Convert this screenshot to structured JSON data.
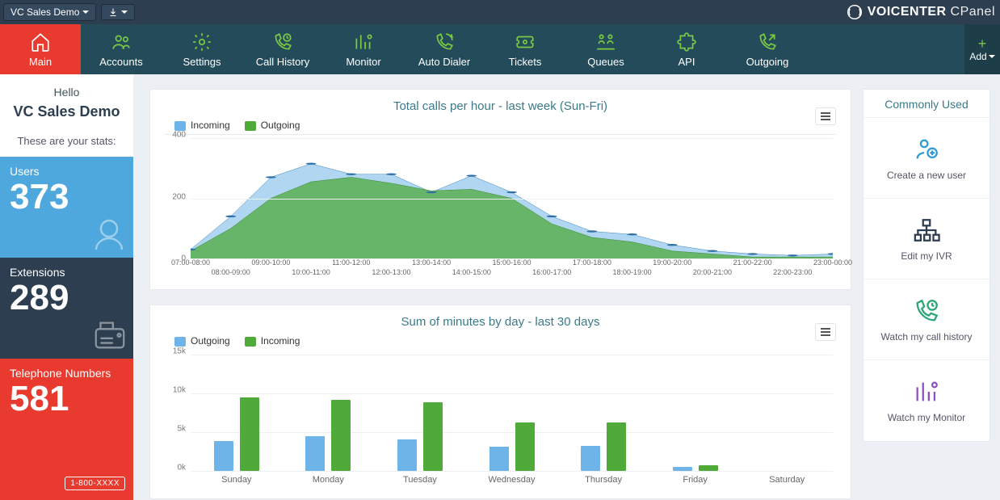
{
  "topbar": {
    "account_selector": "VC Sales Demo",
    "brand_bold": "VOICENTER",
    "brand_light": "CPanel"
  },
  "nav": {
    "items": [
      {
        "label": "Main",
        "icon": "home"
      },
      {
        "label": "Accounts",
        "icon": "users"
      },
      {
        "label": "Settings",
        "icon": "gear"
      },
      {
        "label": "Call History",
        "icon": "clock-phone"
      },
      {
        "label": "Monitor",
        "icon": "bar-person"
      },
      {
        "label": "Auto Dialer",
        "icon": "phone-cycle"
      },
      {
        "label": "Tickets",
        "icon": "ticket"
      },
      {
        "label": "Queues",
        "icon": "queue"
      },
      {
        "label": "API",
        "icon": "puzzle"
      },
      {
        "label": "Outgoing",
        "icon": "phone-out"
      }
    ],
    "add_label": "Add"
  },
  "greeting": {
    "hello": "Hello",
    "name": "VC Sales Demo",
    "stats_label": "These are your stats:"
  },
  "stats": {
    "users": {
      "label": "Users",
      "value": "373"
    },
    "extensions": {
      "label": "Extensions",
      "value": "289"
    },
    "telephone": {
      "label": "Telephone Numbers",
      "value": "581",
      "badge": "1-800-XXXX"
    }
  },
  "right": {
    "title": "Commonly Used",
    "items": [
      {
        "label": "Create a new user",
        "color": "#2e9bd6"
      },
      {
        "label": "Edit my IVR",
        "color": "#2c3e50"
      },
      {
        "label": "Watch my call history",
        "color": "#2aa775"
      },
      {
        "label": "Watch my Monitor",
        "color": "#8e4fc2"
      }
    ]
  },
  "chart1": {
    "title": "Total calls per hour - last week (Sun-Fri)",
    "legend": [
      "Incoming",
      "Outgoing"
    ],
    "ymax": 400
  },
  "chart2": {
    "title": "Sum of minutes by day - last 30 days",
    "legend": [
      "Outgoing",
      "Incoming"
    ],
    "ymax": 15000
  },
  "chart_data": [
    {
      "type": "area",
      "title": "Total calls per hour - last week (Sun-Fri)",
      "xlabel": "",
      "ylabel": "",
      "ylim": [
        0,
        400
      ],
      "categories": [
        "07:00-08:00",
        "08:00-09:00",
        "09:00-10:00",
        "10:00-11:00",
        "11:00-12:00",
        "12:00-13:00",
        "13:00-14:00",
        "14:00-15:00",
        "15:00-16:00",
        "16:00-17:00",
        "17:00-18:00",
        "18:00-19:00",
        "19:00-20:00",
        "20:00-21:00",
        "21:00-22:00",
        "22:00-23:00",
        "23:00-00:00"
      ],
      "series": [
        {
          "name": "Incoming",
          "color": "#6fb4e8",
          "values": [
            30,
            140,
            270,
            315,
            280,
            280,
            220,
            275,
            220,
            140,
            90,
            80,
            45,
            25,
            15,
            10,
            15
          ]
        },
        {
          "name": "Outgoing",
          "color": "#4faa3a",
          "values": [
            25,
            100,
            200,
            255,
            270,
            250,
            225,
            230,
            200,
            115,
            70,
            55,
            25,
            15,
            5,
            5,
            5
          ]
        }
      ]
    },
    {
      "type": "bar",
      "title": "Sum of minutes by day - last 30 days",
      "xlabel": "",
      "ylabel": "",
      "ylim": [
        0,
        15000
      ],
      "categories": [
        "Sunday",
        "Monday",
        "Tuesday",
        "Wednesday",
        "Thursday",
        "Friday",
        "Saturday"
      ],
      "series": [
        {
          "name": "Outgoing",
          "color": "#6fb4e8",
          "values": [
            3900,
            4500,
            4100,
            3100,
            3200,
            500,
            0
          ]
        },
        {
          "name": "Incoming",
          "color": "#4faa3a",
          "values": [
            9500,
            9200,
            8900,
            6300,
            6300,
            700,
            0
          ]
        }
      ]
    }
  ]
}
